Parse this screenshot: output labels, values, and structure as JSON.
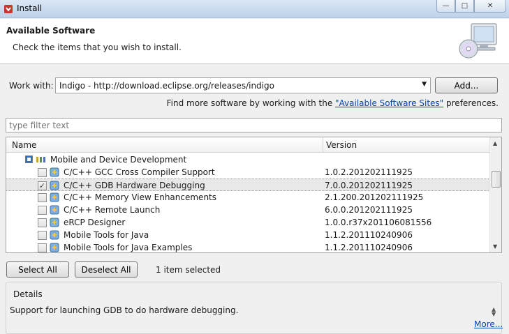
{
  "window": {
    "title": "Install",
    "controls": {
      "minimize": "—",
      "maximize": "□",
      "close": "✕"
    }
  },
  "header": {
    "title": "Available Software",
    "description": "Check the items that you wish to install."
  },
  "work_with": {
    "label": "Work with:",
    "value": "Indigo - http://download.eclipse.org/releases/indigo",
    "add_label": "Add..."
  },
  "find_more": {
    "prefix": "Find more software by working with the ",
    "link": "\"Available Software Sites\"",
    "suffix": " preferences."
  },
  "filter": {
    "placeholder": "type filter text"
  },
  "tree": {
    "columns": {
      "name": "Name",
      "version": "Version"
    },
    "category": {
      "name": "Mobile and Device Development"
    },
    "items": [
      {
        "name": "C/C++ GCC Cross Compiler Support",
        "version": "1.0.2.201202111925",
        "checked": false
      },
      {
        "name": "C/C++ GDB Hardware Debugging",
        "version": "7.0.0.201202111925",
        "checked": true
      },
      {
        "name": "C/C++ Memory View Enhancements",
        "version": "2.1.200.201202111925",
        "checked": false
      },
      {
        "name": "C/C++ Remote Launch",
        "version": "6.0.0.201202111925",
        "checked": false
      },
      {
        "name": "eRCP Designer",
        "version": "1.0.0.r37x201106081556",
        "checked": false
      },
      {
        "name": "Mobile Tools for Java",
        "version": "1.1.2.201110240906",
        "checked": false
      },
      {
        "name": "Mobile Tools for Java Examples",
        "version": "1.1.2.201110240906",
        "checked": false
      }
    ]
  },
  "selection": {
    "select_all_label": "Select All",
    "deselect_all_label": "Deselect All",
    "count_text": "1 item selected"
  },
  "details": {
    "title": "Details",
    "text": "Support for launching GDB to do hardware debugging.",
    "more_label": "More..."
  },
  "colors": {
    "link": "#0645ad",
    "titlebar": "#c9daee"
  }
}
